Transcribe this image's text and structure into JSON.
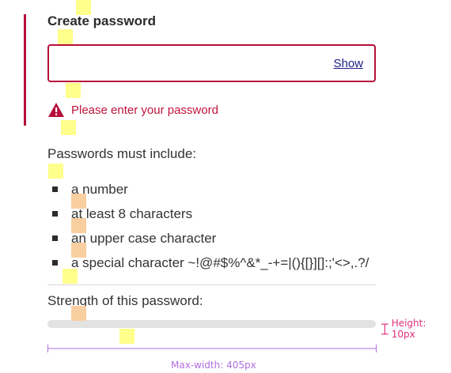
{
  "form": {
    "title": "Create password",
    "password_value": "",
    "show_label": "Show",
    "error_message": "Please enter your password"
  },
  "requirements": {
    "heading": "Passwords must include:",
    "items": [
      {
        "label": "a number"
      },
      {
        "label": "at least 8 characters"
      },
      {
        "label": "an upper case character"
      },
      {
        "label": "a special character  ~!@#$%^&*_-+=|(){[}][]:;'<>,.?/"
      }
    ]
  },
  "strength": {
    "label": "Strength of this password:",
    "level_fraction": 0
  },
  "annotations": {
    "height": "Height: 10px",
    "max_width": "Max-width: 405px"
  },
  "colors": {
    "error": "#b80f3a",
    "meter_track": "#e2e2e2",
    "height_annotation": "#e0307b",
    "width_annotation": "#b26ee0"
  }
}
